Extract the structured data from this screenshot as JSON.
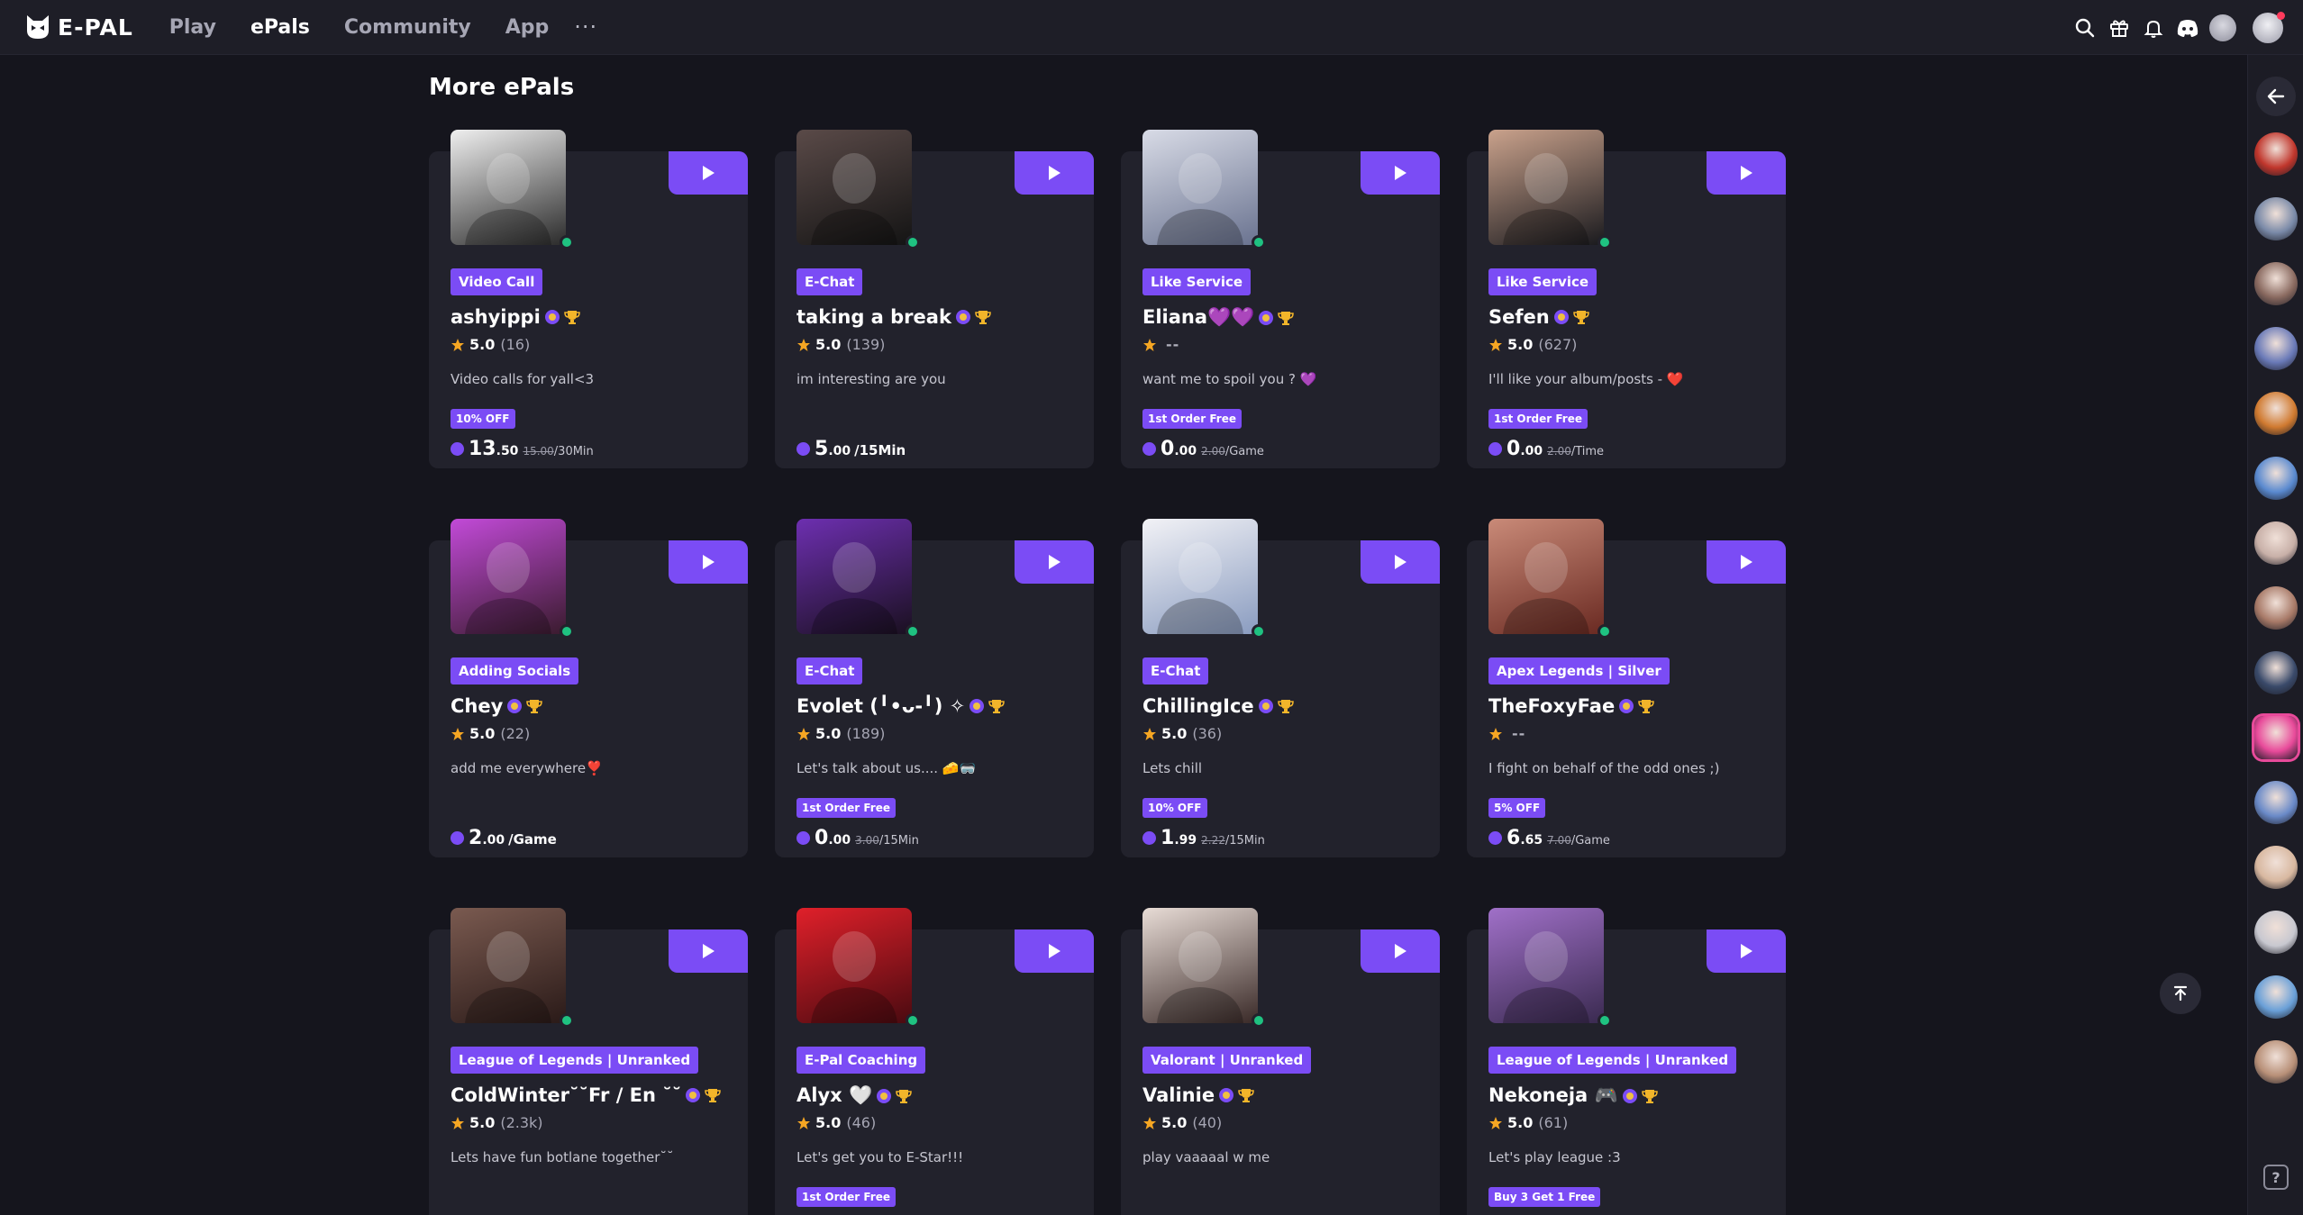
{
  "brand": {
    "name": "E-PAL"
  },
  "nav": {
    "links": [
      "Play",
      "ePals",
      "Community",
      "App"
    ],
    "active": "ePals",
    "more": "···"
  },
  "section": {
    "title": "More ePals"
  },
  "cards": [
    {
      "tag": "Video Call",
      "name": "ashyippi",
      "rating": "5.0",
      "count": "(16)",
      "desc": "Video calls for yall<3",
      "promo": "10% OFF",
      "price_int": "13",
      "price_dec": ".50",
      "price_old": "15.00",
      "unit": "/30Min",
      "colors": [
        "#efefef",
        "#2b2b2b"
      ]
    },
    {
      "tag": "E-Chat",
      "name": "taking a break",
      "rating": "5.0",
      "count": "(139)",
      "desc": "im interesting are you",
      "promo": "",
      "price_int": "5",
      "price_dec": ".00",
      "price_old": "",
      "unit": "/15Min",
      "colors": [
        "#5a4a48",
        "#141414"
      ]
    },
    {
      "tag": "Like Service",
      "name": "Eliana💜💜",
      "rating": "",
      "count": "",
      "desc": "want me to spoil you ? 💜",
      "promo": "1st Order Free",
      "price_int": "0",
      "price_dec": ".00",
      "price_old": "2.00",
      "unit": "/Game",
      "colors": [
        "#d8dbe6",
        "#6a7390"
      ]
    },
    {
      "tag": "Like Service",
      "name": "Sefen",
      "rating": "5.0",
      "count": "(627)",
      "desc": "I'll like your album/posts - ❤️",
      "promo": "1st Order Free",
      "price_int": "0",
      "price_dec": ".00",
      "price_old": "2.00",
      "unit": "/Time",
      "colors": [
        "#caa28c",
        "#1a1a1e"
      ]
    },
    {
      "tag": "Adding Socials",
      "name": "Chey",
      "rating": "5.0",
      "count": "(22)",
      "desc": "add me everywhere❣️",
      "promo": "",
      "price_int": "2",
      "price_dec": ".00",
      "price_old": "",
      "unit": "/Game",
      "colors": [
        "#c24ad8",
        "#3a1b2e"
      ]
    },
    {
      "tag": "E-Chat",
      "name": "Evolet (╹•ᴗ-╹) ✧",
      "rating": "5.0",
      "count": "(189)",
      "desc": "Let's talk about us.... 🧀🥽",
      "promo": "1st Order Free",
      "price_int": "0",
      "price_dec": ".00",
      "price_old": "3.00",
      "unit": "/15Min",
      "colors": [
        "#6d2fb0",
        "#1a1020"
      ]
    },
    {
      "tag": "E-Chat",
      "name": "ChillingIce",
      "rating": "5.0",
      "count": "(36)",
      "desc": "Lets chill",
      "promo": "10% OFF",
      "price_int": "1",
      "price_dec": ".99",
      "price_old": "2.22",
      "unit": "/15Min",
      "colors": [
        "#f2f2f6",
        "#8a9cc0"
      ]
    },
    {
      "tag": "Apex Legends | Silver",
      "name": "TheFoxyFae",
      "rating": "",
      "count": "",
      "desc": "I fight on behalf of the odd ones ;)",
      "promo": "5% OFF",
      "price_int": "6",
      "price_dec": ".65",
      "price_old": "7.00",
      "unit": "/Game",
      "colors": [
        "#c98a78",
        "#6a2a22"
      ]
    },
    {
      "tag": "League of Legends | Unranked",
      "name": "ColdWinter˘˘Fr / En ˘˘",
      "rating": "5.0",
      "count": "(2.3k)",
      "desc": "Lets have fun botlane together˘˘",
      "promo": "",
      "price_int": "",
      "price_dec": "",
      "price_old": "",
      "unit": "",
      "colors": [
        "#7a5a50",
        "#2a1a18"
      ]
    },
    {
      "tag": "E-Pal Coaching",
      "name": "Alyx 🤍",
      "rating": "5.0",
      "count": "(46)",
      "desc": "Let's get you to E-Star!!!",
      "promo": "1st Order Free",
      "price_int": "",
      "price_dec": "",
      "price_old": "",
      "unit": "",
      "colors": [
        "#e0202a",
        "#4a0a10"
      ]
    },
    {
      "tag": "Valorant | Unranked",
      "name": "Valinie",
      "rating": "5.0",
      "count": "(40)",
      "desc": "play vaaaaal w me",
      "promo": "",
      "price_int": "",
      "price_dec": "",
      "price_old": "",
      "unit": "",
      "colors": [
        "#e8dcd6",
        "#3a2a28"
      ]
    },
    {
      "tag": "League of Legends | Unranked",
      "name": "Nekoneja 🎮",
      "rating": "5.0",
      "count": "(61)",
      "desc": "Let's play league :3",
      "promo": "Buy 3 Get 1 Free",
      "price_int": "",
      "price_dec": "",
      "price_old": "",
      "unit": "",
      "colors": [
        "#a070c8",
        "#3a2a50"
      ]
    }
  ],
  "rail": {
    "avatars": [
      "#c0362c",
      "#7a8aa8",
      "#8a6a60",
      "#6a7ab8",
      "#d07a30",
      "#5a8ad0",
      "#c8b0a8",
      "#a87a68",
      "#3a4a6a",
      "#e84a9a",
      "#6a8ac8",
      "#d8b8a0",
      "#c8c8d0",
      "#6aa0d8",
      "#b89078"
    ]
  },
  "help": "?"
}
